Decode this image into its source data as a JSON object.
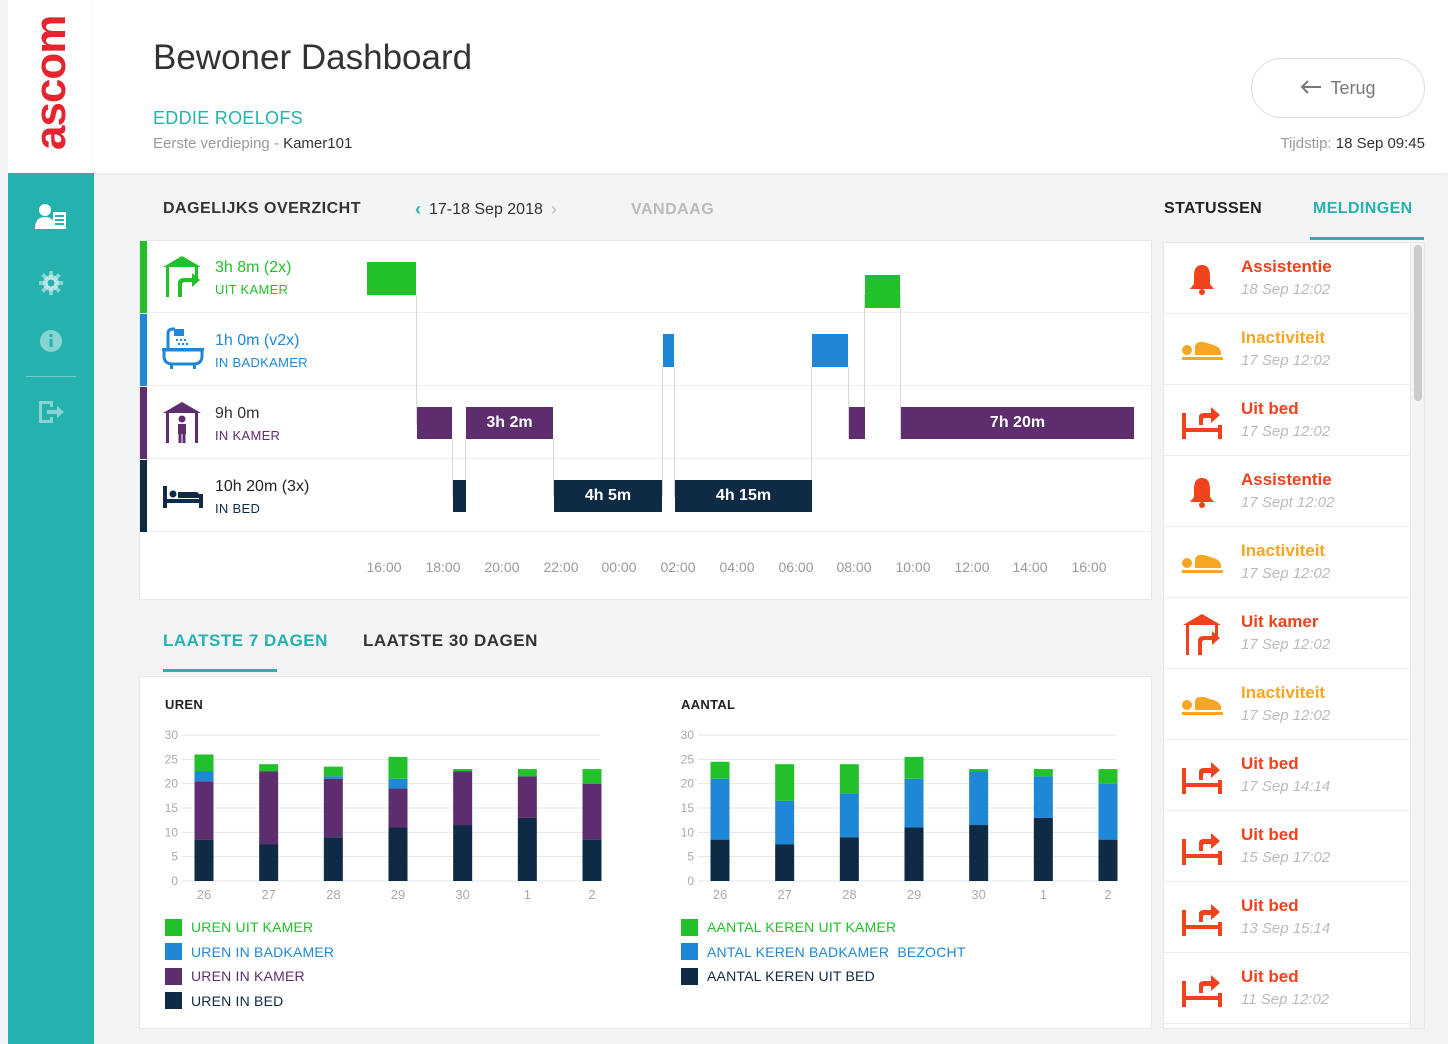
{
  "app": {
    "logo": "ascom"
  },
  "header": {
    "title": "Bewoner Dashboard",
    "resident_name": "EDDIE ROELOFS",
    "floor": "Eerste verdieping",
    "separator": " - ",
    "room": "Kamer101",
    "back_label": "Terug",
    "timestamp_label": "Tijdstip:",
    "timestamp_value": "18 Sep 09:45"
  },
  "sidebar": {
    "items": [
      {
        "icon": "resident-list-icon",
        "active": true
      },
      {
        "icon": "gear-icon"
      },
      {
        "icon": "info-icon"
      },
      {
        "icon": "logout-icon"
      }
    ]
  },
  "daily": {
    "title": "DAGELIJKS OVERZICHT",
    "date_range": "17-18 Sep 2018",
    "today": "VANDAAG",
    "lanes": [
      {
        "value": "3h 8m (2x)",
        "label": "UIT KAMER",
        "color": "#22c02a",
        "icon": "out-of-room-icon"
      },
      {
        "value": "1h 0m (v2x)",
        "label": "IN BADKAMER",
        "color": "#1f88d6",
        "icon": "bathtub-icon"
      },
      {
        "value": "9h 0m",
        "label": "IN KAMER",
        "color": "#5e2d6e",
        "icon": "in-room-icon"
      },
      {
        "value": "10h 20m (3x)",
        "label": "IN BED",
        "color": "#0f2a45",
        "icon": "bed-icon"
      }
    ],
    "segments": {
      "kamer_1": "3h 2m",
      "kamer_2": "7h 20m",
      "bed_1": "4h 5m",
      "bed_2": "4h 15m"
    },
    "ticks": [
      "16:00",
      "18:00",
      "20:00",
      "22:00",
      "00:00",
      "02:00",
      "04:00",
      "06:00",
      "08:00",
      "10:00",
      "12:00",
      "14:00",
      "16:00"
    ]
  },
  "tabs": {
    "last7": "LAATSTE 7 DAGEN",
    "last30": "LAATSTE 30 DAGEN"
  },
  "colors": {
    "green": "#22c02a",
    "blue": "#1f88d6",
    "purple": "#5e2d6e",
    "navy": "#0f2a45",
    "teal": "#25b1ad",
    "red": "#f0421c",
    "orange": "#f5a623"
  },
  "chart_data": [
    {
      "type": "bar",
      "title": "UREN",
      "stacked": true,
      "categories": [
        "26",
        "27",
        "28",
        "29",
        "30",
        "1",
        "2"
      ],
      "ylim": [
        0,
        30
      ],
      "yticks": [
        0,
        5,
        10,
        15,
        20,
        25,
        30
      ],
      "grid": true,
      "series": [
        {
          "name": "UREN IN BED",
          "color": "#0f2a45",
          "values": [
            8.5,
            7.5,
            9,
            11,
            11.5,
            13,
            8.5
          ]
        },
        {
          "name": "UREN IN KAMER",
          "color": "#5e2d6e",
          "values": [
            12,
            15,
            12,
            8,
            11,
            8.5,
            11.5
          ]
        },
        {
          "name": "UREN IN BADKAMER",
          "color": "#1f88d6",
          "values": [
            2,
            0,
            0.5,
            2,
            0,
            0,
            0
          ]
        },
        {
          "name": "UREN UIT KAMER",
          "color": "#22c02a",
          "values": [
            3.5,
            1.5,
            2,
            4.5,
            0.5,
            1.5,
            3
          ]
        }
      ]
    },
    {
      "type": "bar",
      "title": "AANTAL",
      "stacked": true,
      "categories": [
        "26",
        "27",
        "28",
        "29",
        "30",
        "1",
        "2"
      ],
      "ylim": [
        0,
        30
      ],
      "yticks": [
        0,
        5,
        10,
        15,
        20,
        25,
        30
      ],
      "grid": true,
      "series": [
        {
          "name": "AANTAL KEREN UIT BED",
          "color": "#0f2a45",
          "values": [
            8.5,
            7.5,
            9,
            11,
            11.5,
            13,
            8.5
          ]
        },
        {
          "name": "ANTAL KEREN BADKAMER  BEZOCHT",
          "color": "#1f88d6",
          "values": [
            12.5,
            9,
            9,
            10,
            11,
            8.5,
            11.5
          ]
        },
        {
          "name": "AANTAL KEREN UIT KAMER",
          "color": "#22c02a",
          "values": [
            3.5,
            7.5,
            6,
            4.5,
            0.5,
            1.5,
            3
          ]
        }
      ]
    }
  ],
  "legend_left": [
    "UREN UIT KAMER",
    "UREN IN BADKAMER",
    "UREN IN KAMER",
    "UREN IN BED"
  ],
  "legend_right": [
    "AANTAL KEREN UIT KAMER",
    "ANTAL KEREN BADKAMER  BEZOCHT",
    "AANTAL KEREN UIT BED"
  ],
  "right_panel": {
    "tab_status": "STATUSSEN",
    "tab_alerts": "MELDINGEN",
    "alerts": [
      {
        "title": "Assistentie",
        "time": "18 Sep 12:02",
        "icon": "bell-icon",
        "color": "#f0421c"
      },
      {
        "title": "Inactiviteit",
        "time": "17 Sep 12:02",
        "icon": "inactivity-icon",
        "color": "#f5a623"
      },
      {
        "title": "Uit bed",
        "time": "17 Sep 12:02",
        "icon": "out-of-bed-icon",
        "color": "#f0421c"
      },
      {
        "title": "Assistentie",
        "time": "17 Sept 12:02",
        "icon": "bell-icon",
        "color": "#f0421c"
      },
      {
        "title": "Inactiviteit",
        "time": "17 Sep 12:02",
        "icon": "inactivity-icon",
        "color": "#f5a623"
      },
      {
        "title": "Uit kamer",
        "time": "17 Sep 12:02",
        "icon": "out-of-room-icon",
        "color": "#f0421c"
      },
      {
        "title": "Inactiviteit",
        "time": "17 Sep 12:02",
        "icon": "inactivity-icon",
        "color": "#f5a623"
      },
      {
        "title": "Uit bed",
        "time": "17 Sep 14:14",
        "icon": "out-of-bed-icon",
        "color": "#f0421c"
      },
      {
        "title": "Uit bed",
        "time": "15 Sep 17:02",
        "icon": "out-of-bed-icon",
        "color": "#f0421c"
      },
      {
        "title": "Uit bed",
        "time": "13 Sep 15:14",
        "icon": "out-of-bed-icon",
        "color": "#f0421c"
      },
      {
        "title": "Uit bed",
        "time": "11 Sep 12:02",
        "icon": "out-of-bed-icon",
        "color": "#f0421c"
      }
    ]
  }
}
